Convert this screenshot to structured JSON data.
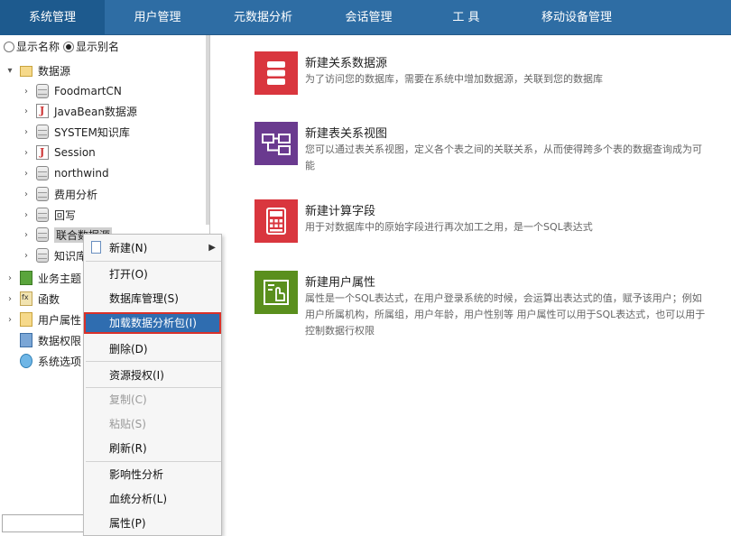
{
  "menubar": {
    "tabs": [
      "系统管理",
      "用户管理",
      "元数据分析",
      "会话管理",
      "工 具",
      "移动设备管理"
    ],
    "active_index": 0
  },
  "sidebar": {
    "display_options": [
      {
        "label": "显示名称",
        "checked": false
      },
      {
        "label": "显示别名",
        "checked": true
      }
    ],
    "tree": [
      {
        "label": "数据源",
        "icon": "folder-icon",
        "expanded": true
      },
      {
        "label": "FoodmartCN",
        "icon": "database-icon"
      },
      {
        "label": "JavaBean数据源",
        "icon": "java-icon"
      },
      {
        "label": "SYSTEM知识库",
        "icon": "database-icon"
      },
      {
        "label": "Session",
        "icon": "java-icon"
      },
      {
        "label": "northwind",
        "icon": "database-icon"
      },
      {
        "label": "费用分析",
        "icon": "database-icon"
      },
      {
        "label": "回写",
        "icon": "database-icon"
      },
      {
        "label": "联合数据源",
        "icon": "database-icon",
        "highlighted": true
      },
      {
        "label": "知识库",
        "icon": "database-icon"
      },
      {
        "label": "业务主题",
        "icon": "business-theme-icon"
      },
      {
        "label": "函数",
        "icon": "function-icon"
      },
      {
        "label": "用户属性",
        "icon": "user-attribute-icon"
      },
      {
        "label": "数据权限",
        "icon": "data-permission-icon"
      },
      {
        "label": "系统选项",
        "icon": "system-options-icon"
      }
    ]
  },
  "context_menu": {
    "items": [
      {
        "label": "新建(N)",
        "has_submenu": true,
        "icon": "new-icon"
      },
      {
        "label": "打开(O)"
      },
      {
        "label": "数据库管理(S)"
      },
      {
        "label": "加载数据分析包(I)",
        "selected": true
      },
      {
        "label": "删除(D)"
      },
      {
        "label": "资源授权(I)"
      },
      {
        "label": "复制(C)",
        "disabled": true
      },
      {
        "label": "粘贴(S)",
        "disabled": true
      },
      {
        "label": "刷新(R)"
      },
      {
        "label": "影响性分析"
      },
      {
        "label": "血统分析(L)"
      },
      {
        "label": "属性(P)"
      }
    ]
  },
  "main": {
    "cards": [
      {
        "title": "新建关系数据源",
        "desc": "为了访问您的数据库，需要在系统中增加数据源，关联到您的数据库",
        "color": "#d9363e",
        "icon": "relational-datasource-icon"
      },
      {
        "title": "新建表关系视图",
        "desc": "您可以通过表关系视图，定义各个表之间的关联关系，从而使得跨多个表的数据查询成为可能",
        "color": "#6a3a8f",
        "icon": "table-relation-view-icon"
      },
      {
        "title": "新建计算字段",
        "desc": "用于对数据库中的原始字段进行再次加工之用，是一个SQL表达式",
        "color": "#d9363e",
        "icon": "calculator-icon"
      },
      {
        "title": "新建用户属性",
        "desc": "属性是一个SQL表达式，在用户登录系统的时候，会运算出表达式的值，赋予该用户；例如用户所属机构，所属组，用户年龄，用户性别等 用户属性可以用于SQL表达式，也可以用于控制数据行权限",
        "color": "#5a8f1d",
        "icon": "user-attribute-icon"
      }
    ]
  }
}
